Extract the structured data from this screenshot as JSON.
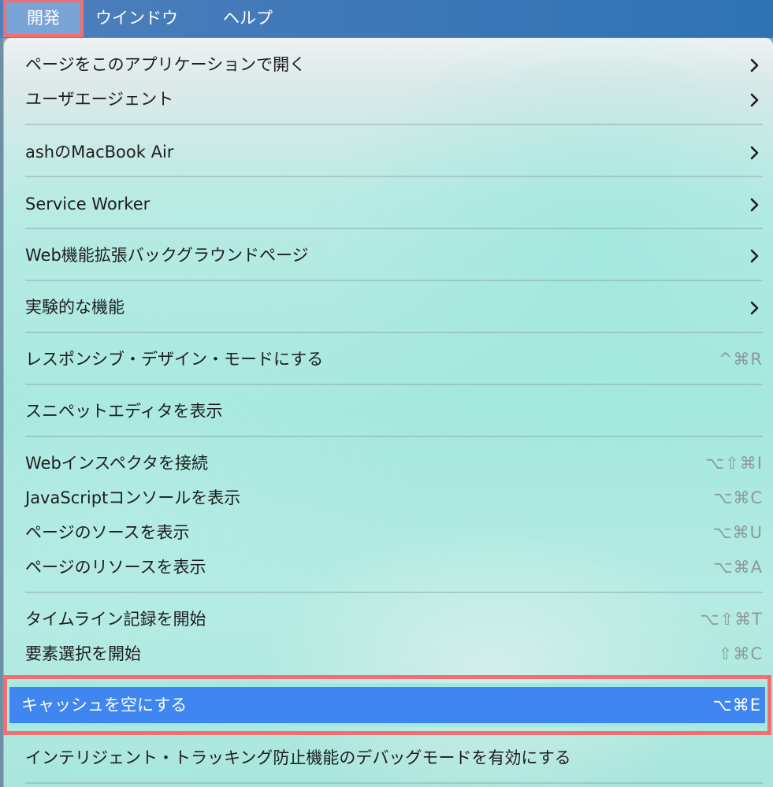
{
  "menubar": {
    "develop": "開発",
    "window": "ウインドウ",
    "help": "ヘルプ"
  },
  "menu": {
    "items": [
      {
        "label": "ページをこのアプリケーションで開く",
        "submenu": true
      },
      {
        "label": "ユーザエージェント",
        "submenu": true
      },
      {
        "label": "ashのMacBook Air",
        "submenu": true
      },
      {
        "label": "Service Worker",
        "submenu": true
      },
      {
        "label": "Web機能拡張バックグラウンドページ",
        "submenu": true
      },
      {
        "label": "実験的な機能",
        "submenu": true
      },
      {
        "label": "レスポンシブ・デザイン・モードにする",
        "shortcut": "^⌘R"
      },
      {
        "label": "スニペットエディタを表示"
      },
      {
        "label": "Webインスペクタを接続",
        "shortcut": "⌥⇧⌘I"
      },
      {
        "label": "JavaScriptコンソールを表示",
        "shortcut": "⌥⌘C"
      },
      {
        "label": "ページのソースを表示",
        "shortcut": "⌥⌘U"
      },
      {
        "label": "ページのリソースを表示",
        "shortcut": "⌥⌘A"
      },
      {
        "label": "タイムライン記録を開始",
        "shortcut": "⌥⇧⌘T"
      },
      {
        "label": "要素選択を開始",
        "shortcut": "⇧⌘C"
      },
      {
        "label": "キャッシュを空にする",
        "shortcut": "⌥⌘E",
        "selected": true
      },
      {
        "label": "インテリジェント・トラッキング防止機能のデバッグモードを有効にする"
      }
    ]
  },
  "icons": {
    "submenu": "chevron-right-icon"
  },
  "colors": {
    "menubar": "#3f78b8",
    "selection": "#3f86f0",
    "highlight_frame": "#ef6f72"
  }
}
